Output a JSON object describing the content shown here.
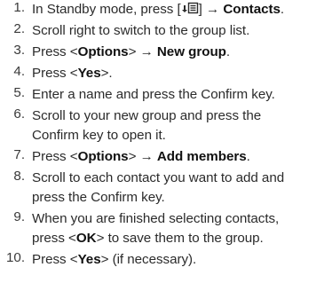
{
  "steps": [
    {
      "num": "1.",
      "a": "In Standby mode, press [",
      "icon": "menu-key-icon",
      "b": "] → ",
      "bold": "Contacts",
      "c": "."
    },
    {
      "num": "2.",
      "a": "Scroll right to switch to the group list."
    },
    {
      "num": "3.",
      "a": "Press <",
      "bold": "Options",
      "b": "> → ",
      "bold2": "New group",
      "c": "."
    },
    {
      "num": "4.",
      "a": "Press <",
      "bold": "Yes",
      "b": ">."
    },
    {
      "num": "5.",
      "a": "Enter a name and press the Confirm key."
    },
    {
      "num": "6.",
      "line1": "Scroll to your new group and press the",
      "line2": "Confirm key to open it."
    },
    {
      "num": "7.",
      "a": "Press <",
      "bold": "Options",
      "b": "> → ",
      "bold2": "Add members",
      "c": "."
    },
    {
      "num": "8.",
      "line1": "Scroll to each contact you want to add and",
      "line2": "press the Confirm key."
    },
    {
      "num": "9.",
      "line1": "When you are finished selecting contacts,",
      "l2a": "press <",
      "l2bold": "OK",
      "l2b": "> to save them to the group."
    },
    {
      "num": "10.",
      "a": "Press <",
      "bold": "Yes",
      "b": "> (if necessary)."
    }
  ]
}
